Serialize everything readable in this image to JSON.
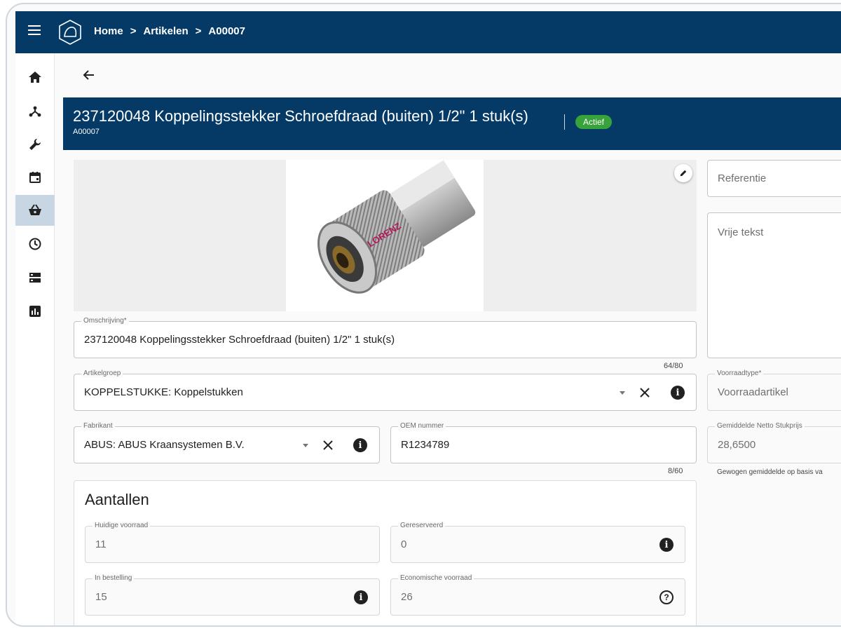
{
  "breadcrumb": {
    "home": "Home",
    "section": "Artikelen",
    "current": "A00007",
    "separator": ">"
  },
  "header": {
    "title": "237120048 Koppelingsstekker Schroefdraad (buiten) 1/2\" 1 stuk(s)",
    "subtitle": "A00007",
    "status": "Actief"
  },
  "colors": {
    "primary": "#053a66",
    "status_active": "#39a33b",
    "sidebar_active": "#c8d6e4"
  },
  "sidebar": {
    "items": [
      {
        "icon": "home-icon"
      },
      {
        "icon": "hierarchy-icon"
      },
      {
        "icon": "wrench-icon"
      },
      {
        "icon": "calendar-icon"
      },
      {
        "icon": "basket-icon",
        "active": true
      },
      {
        "icon": "clock-icon"
      },
      {
        "icon": "storage-icon"
      },
      {
        "icon": "report-icon"
      }
    ]
  },
  "form": {
    "omschrijving": {
      "label": "Omschrijving*",
      "value": "237120048 Koppelingsstekker Schroefdraad (buiten) 1/2\" 1 stuk(s)",
      "counter": "64/80"
    },
    "artikelgroep": {
      "label": "Artikelgroep",
      "value": "KOPPELSTUKKE: Koppelstukken"
    },
    "fabrikant": {
      "label": "Fabrikant",
      "value": "ABUS: ABUS Kraansystemen B.V."
    },
    "oem": {
      "label": "OEM nummer",
      "value": "R1234789",
      "counter": "8/60"
    },
    "referentie": {
      "placeholder": "Referentie"
    },
    "vrije_tekst": {
      "placeholder": "Vrije tekst"
    },
    "voorraadtype": {
      "label": "Voorraadtype*",
      "value": "Voorraadartikel"
    },
    "stukprijs": {
      "label": "Gemiddelde Netto Stukprijs",
      "value": "28,6500",
      "helper": "Gewogen gemiddelde op basis va"
    }
  },
  "aantallen": {
    "title": "Aantallen",
    "huidige": {
      "label": "Huidige voorraad",
      "value": "11"
    },
    "gereserveerd": {
      "label": "Gereserveerd",
      "value": "0"
    },
    "in_bestelling": {
      "label": "In bestelling",
      "value": "15"
    },
    "economische": {
      "label": "Economische voorraad",
      "value": "26"
    }
  }
}
